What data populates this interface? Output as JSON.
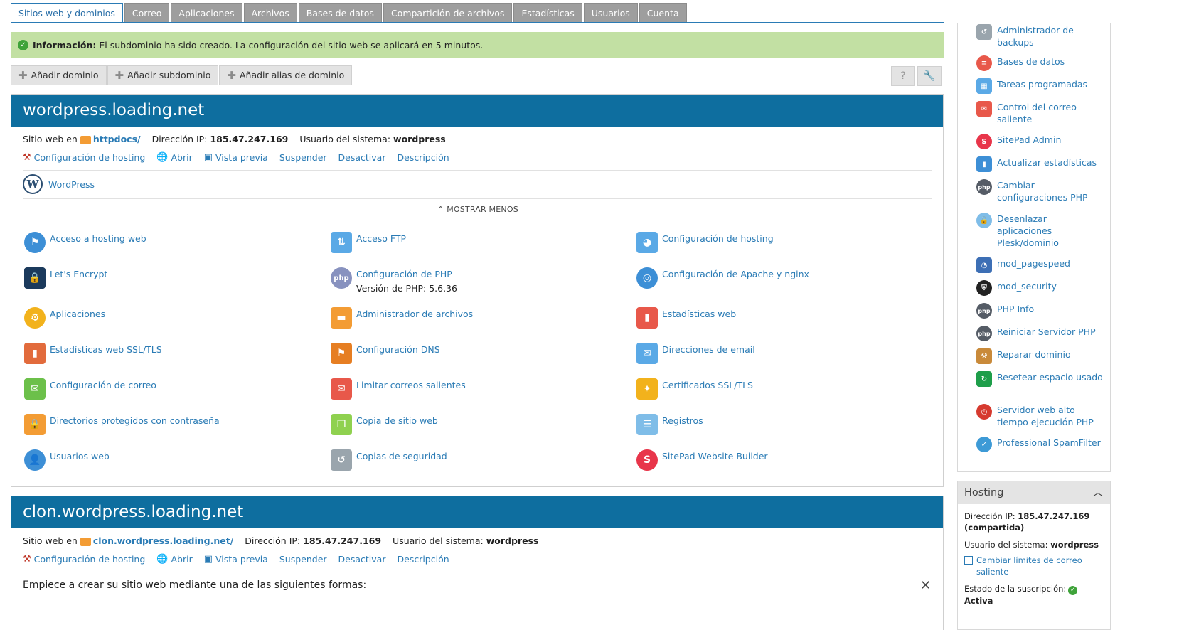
{
  "tabs": [
    {
      "label": "Sitios web y dominios",
      "active": true
    },
    {
      "label": "Correo"
    },
    {
      "label": "Aplicaciones"
    },
    {
      "label": "Archivos"
    },
    {
      "label": "Bases de datos"
    },
    {
      "label": "Compartición de archivos"
    },
    {
      "label": "Estadísticas"
    },
    {
      "label": "Usuarios"
    },
    {
      "label": "Cuenta"
    }
  ],
  "info": {
    "title": "Información:",
    "message": "El subdominio ha sido creado. La configuración del sitio web se aplicará en 5 minutos."
  },
  "toolbar": {
    "add_domain": "Añadir dominio",
    "add_subdomain": "Añadir subdominio",
    "add_alias": "Añadir alias de dominio",
    "help": "?",
    "tools": "🔧"
  },
  "domain1": {
    "name": "wordpress.loading.net",
    "site_at_label": "Sitio web en",
    "site_at_value": "httpdocs/",
    "ip_label": "Dirección IP:",
    "ip_value": "185.47.247.169",
    "user_label": "Usuario del sistema:",
    "user_value": "wordpress",
    "actions": {
      "hosting": "Configuración de hosting",
      "open": "Abrir",
      "preview": "Vista previa",
      "suspend": "Suspender",
      "disable": "Desactivar",
      "description": "Descripción"
    },
    "wordpress": "WordPress",
    "show_less": "MOSTRAR MENOS",
    "items": {
      "c1r1": "Acceso a hosting web",
      "c1r2": "Let's Encrypt",
      "c1r3": "Aplicaciones",
      "c1r4": "Estadísticas web SSL/TLS",
      "c1r5": "Configuración de correo",
      "c1r6": "Directorios protegidos con contraseña",
      "c1r7": "Usuarios web",
      "c2r1": "Acceso FTP",
      "c2r2": "Configuración de PHP",
      "c2r2_sub": "Versión de PHP: 5.6.36",
      "c2r3": "Administrador de archivos",
      "c2r4": "Configuración DNS",
      "c2r5": "Limitar correos salientes",
      "c2r6": "Copia de sitio web",
      "c2r7": "Copias de seguridad",
      "c3r1": "Configuración de hosting",
      "c3r2": "Configuración de Apache y nginx",
      "c3r3": "Estadísticas web",
      "c3r4": "Direcciones de email",
      "c3r5": "Certificados SSL/TLS",
      "c3r6": "Registros",
      "c3r7": "SitePad Website Builder"
    }
  },
  "domain2": {
    "name": "clon.wordpress.loading.net",
    "site_at_label": "Sitio web en",
    "site_at_value": "clon.wordpress.loading.net/",
    "ip_label": "Dirección IP:",
    "ip_value": "185.47.247.169",
    "user_label": "Usuario del sistema:",
    "user_value": "wordpress",
    "actions": {
      "hosting": "Configuración de hosting",
      "open": "Abrir",
      "preview": "Vista previa",
      "suspend": "Suspender",
      "disable": "Desactivar",
      "description": "Descripción"
    },
    "start_text": "Empiece a crear su sitio web mediante una de las siguientes formas:"
  },
  "sidebar": {
    "items": [
      "Administrador de backups",
      "Bases de datos",
      "Tareas programadas",
      "Control del correo saliente",
      "SitePad Admin",
      "Actualizar estadísticas",
      "Cambiar configuraciones PHP",
      "Desenlazar aplicaciones Plesk/dominio",
      "mod_pagespeed",
      "mod_security",
      "PHP Info",
      "Reiniciar Servidor PHP",
      "Reparar dominio",
      "Resetear espacio usado",
      "Servidor web alto tiempo ejecución PHP",
      "Professional SpamFilter"
    ]
  },
  "hosting": {
    "title": "Hosting",
    "ip_label": "Dirección IP:",
    "ip_value": "185.47.247.169",
    "ip_note": "(compartida)",
    "user_label": "Usuario del sistema:",
    "user_value": "wordpress",
    "mail_limits": "Cambiar límites de correo saliente",
    "status_label": "Estado de la suscripción:",
    "status_value": "Activa"
  },
  "colors": {
    "header_blue": "#0e6e9f",
    "link": "#2a7bb5",
    "success_bg": "#c2e0a3"
  }
}
